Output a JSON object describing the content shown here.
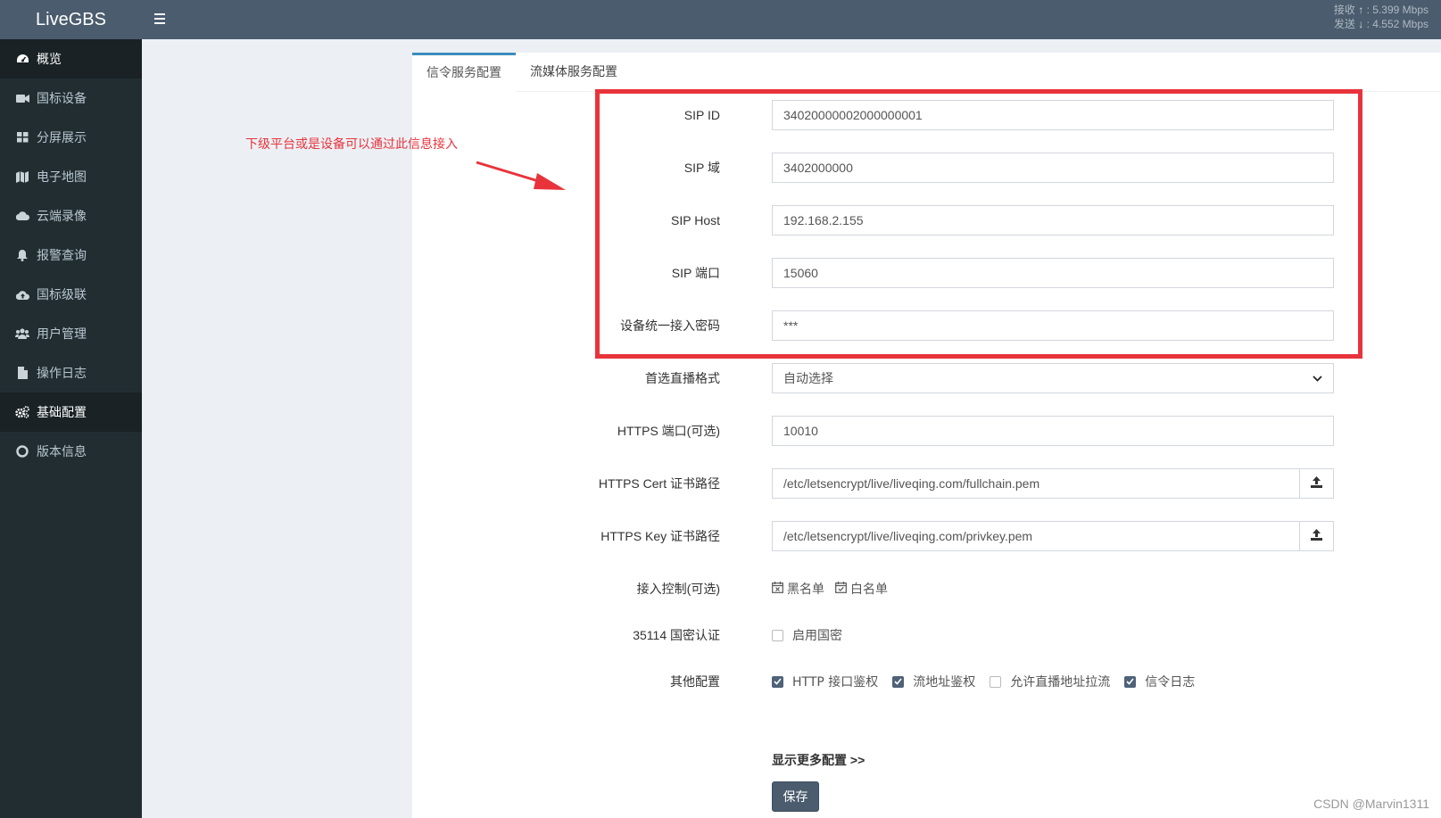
{
  "app": {
    "title": "LiveGBS"
  },
  "network": {
    "recv_label": "接收",
    "recv_value": ": 5.399 Mbps",
    "send_label": "发送",
    "send_value": ": 4.552 Mbps"
  },
  "sidebar": {
    "items": [
      {
        "label": "概览",
        "icon": "dashboard-icon"
      },
      {
        "label": "国标设备",
        "icon": "camera-icon"
      },
      {
        "label": "分屏展示",
        "icon": "grid-icon"
      },
      {
        "label": "电子地图",
        "icon": "map-icon"
      },
      {
        "label": "云端录像",
        "icon": "cloud-icon"
      },
      {
        "label": "报警查询",
        "icon": "bell-icon"
      },
      {
        "label": "国标级联",
        "icon": "cloud-upload-icon"
      },
      {
        "label": "用户管理",
        "icon": "users-icon"
      },
      {
        "label": "操作日志",
        "icon": "file-icon"
      },
      {
        "label": "基础配置",
        "icon": "cogs-icon"
      },
      {
        "label": "版本信息",
        "icon": "lifebuoy-icon"
      }
    ]
  },
  "tabs": [
    {
      "label": "信令服务配置"
    },
    {
      "label": "流媒体服务配置"
    }
  ],
  "form": {
    "sip_id": {
      "label": "SIP ID",
      "value": "34020000002000000001"
    },
    "sip_domain": {
      "label": "SIP 域",
      "value": "3402000000"
    },
    "sip_host": {
      "label": "SIP Host",
      "value": "192.168.2.155"
    },
    "sip_port": {
      "label": "SIP 端口",
      "value": "15060"
    },
    "password": {
      "label": "设备统一接入密码",
      "value": "***"
    },
    "live_format": {
      "label": "首选直播格式",
      "value": "自动选择"
    },
    "https_port": {
      "label": "HTTPS 端口(可选)",
      "value": "10010"
    },
    "https_cert": {
      "label": "HTTPS Cert 证书路径",
      "value": "/etc/letsencrypt/live/liveqing.com/fullchain.pem"
    },
    "https_key": {
      "label": "HTTPS Key 证书路径",
      "value": "/etc/letsencrypt/live/liveqing.com/privkey.pem"
    },
    "access_control": {
      "label": "接入控制(可选)",
      "blacklist": "黑名单",
      "whitelist": "白名单"
    },
    "gm_auth": {
      "label": "35114 国密认证",
      "option": "启用国密"
    },
    "other": {
      "label": "其他配置",
      "http_auth": "HTTP 接口鉴权",
      "stream_auth": "流地址鉴权",
      "allow_pull": "允许直播地址拉流",
      "signal_log": "信令日志"
    },
    "more": "显示更多配置 >>",
    "save": "保存"
  },
  "annotation": {
    "text": "下级平台或是设备可以通过此信息接入"
  },
  "watermark": "CSDN @Marvin1311",
  "colors": {
    "sidebar": "#222d32",
    "topbar": "#4b5c6e",
    "highlight": "#e8333b",
    "accent": "#3c8dbc"
  }
}
